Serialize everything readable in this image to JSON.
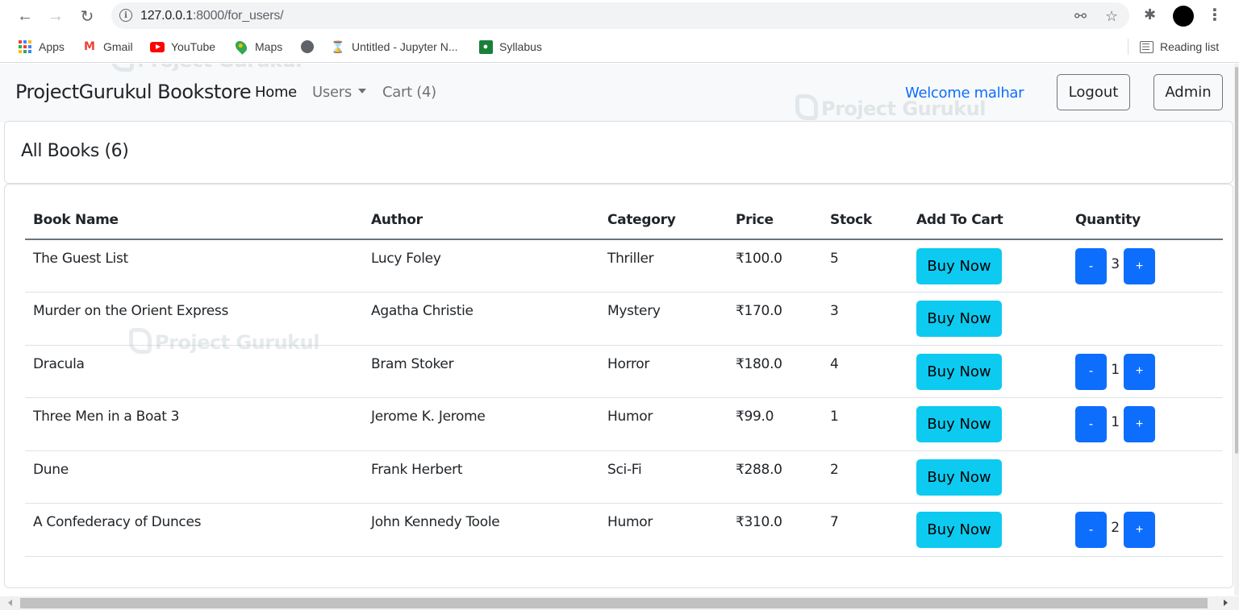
{
  "browser": {
    "url_host": "127.0.0.1",
    "url_rest": ":8000/for_users/",
    "bookmarks": [
      {
        "label": "Apps",
        "icon": "apps-grid-icon"
      },
      {
        "label": "Gmail",
        "icon": "gmail-icon"
      },
      {
        "label": "YouTube",
        "icon": "youtube-icon"
      },
      {
        "label": "Maps",
        "icon": "maps-icon"
      },
      {
        "label": "",
        "icon": "globe-icon"
      },
      {
        "label": "Untitled - Jupyter N...",
        "icon": "hourglass-icon"
      },
      {
        "label": "Syllabus",
        "icon": "classroom-icon"
      }
    ],
    "reading_list": "Reading list"
  },
  "navbar": {
    "brand": "ProjectGurukul Bookstore",
    "links": {
      "home": "Home",
      "users": "Users",
      "cart": "Cart (4)"
    },
    "welcome": "Welcome malhar",
    "logout": "Logout",
    "admin": "Admin"
  },
  "page": {
    "title": "All Books (6)",
    "watermark": "Project Gurukul"
  },
  "table": {
    "headers": [
      "Book Name",
      "Author",
      "Category",
      "Price",
      "Stock",
      "Add To Cart",
      "Quantity"
    ],
    "buy_label": "Buy Now",
    "minus_label": "-",
    "plus_label": "+",
    "rows": [
      {
        "name": "The Guest List",
        "author": "Lucy Foley",
        "category": "Thriller",
        "price": "₹100.0",
        "stock": "5",
        "quantity": "3"
      },
      {
        "name": "Murder on the Orient Express",
        "author": "Agatha Christie",
        "category": "Mystery",
        "price": "₹170.0",
        "stock": "3",
        "quantity": null
      },
      {
        "name": "Dracula",
        "author": "Bram Stoker",
        "category": "Horror",
        "price": "₹180.0",
        "stock": "4",
        "quantity": "1"
      },
      {
        "name": "Three Men in a Boat 3",
        "author": "Jerome K. Jerome",
        "category": "Humor",
        "price": "₹99.0",
        "stock": "1",
        "quantity": "1"
      },
      {
        "name": "Dune",
        "author": "Frank Herbert",
        "category": "Sci-Fi",
        "price": "₹288.0",
        "stock": "2",
        "quantity": null
      },
      {
        "name": "A Confederacy of Dunces",
        "author": "John Kennedy Toole",
        "category": "Humor",
        "price": "₹310.0",
        "stock": "7",
        "quantity": "2"
      }
    ]
  },
  "colors": {
    "primary": "#0d6efd",
    "info": "#0dcaf0",
    "navbar_bg": "#f8f9fa"
  }
}
